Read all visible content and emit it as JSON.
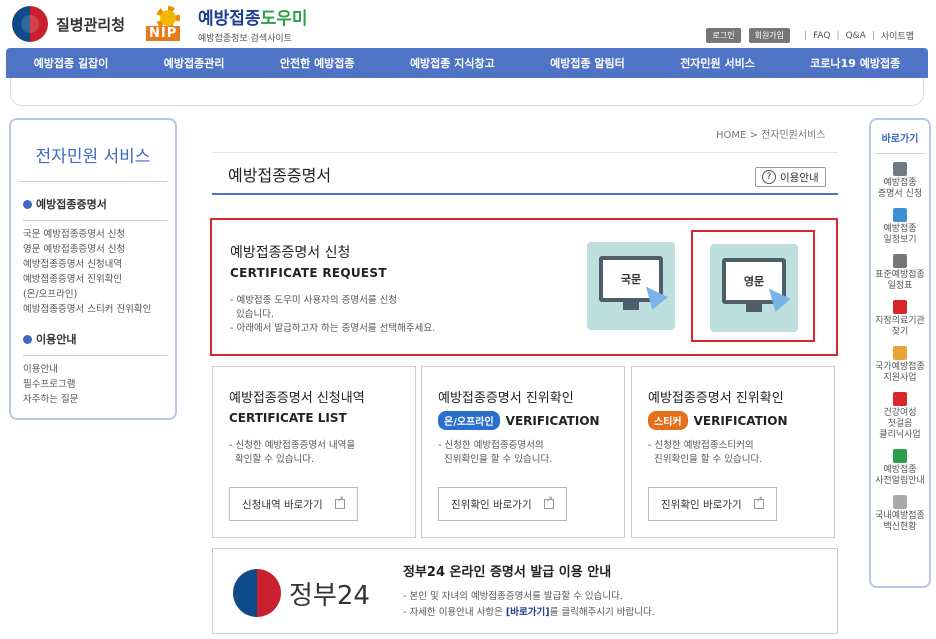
{
  "header": {
    "kdca_logo_text": "질병관리청",
    "nip_logo_text": "예방접종도우미",
    "nip_logo_text_a": "예방접종",
    "nip_logo_text_b": "도우미",
    "nip_badge": "NIP",
    "nip_sub": "예방접종정보 검색사이트",
    "util": {
      "login": "로그인",
      "join": "회원가입",
      "faq": "FAQ",
      "qa": "Q&A",
      "sitemap": "사이트맵"
    }
  },
  "gnb": [
    "예방접종 길잡이",
    "예방접종관리",
    "안전한 예방접종",
    "예방접종 지식창고",
    "예방접종 알림터",
    "전자민원 서비스",
    "코로나19 예방접종"
  ],
  "lnb": {
    "title": "전자민원 서비스",
    "group1": "예방접종증명서",
    "items1": [
      "국문 예방접종증명서 신청",
      "영문 예방접종증명서 신청",
      "예방접종증명서 신청내역",
      "예방접종증명서 진위확인",
      "(온/오프라인)",
      "예방접종증명서 스티커 진위확인"
    ],
    "group2": "이용안내",
    "items2": [
      "이용안내",
      "필수프로그램",
      "자주하는 질문"
    ]
  },
  "breadcrumb": "HOME  >  전자민원서비스",
  "page_title": "예방접종증명서",
  "usage_button": "이용안내",
  "request": {
    "title": "예방접종증명서 신청",
    "subtitle": "CERTIFICATE REQUEST",
    "desc1": "- 예방접종 도우미 사용자의 증명서를 신청",
    "desc1b": "  있습니다.",
    "desc2": "- 아래에서 발급하고자 하는 증명서를 선택해주세요.",
    "korean_tile": "국문",
    "english_tile": "영문"
  },
  "cards": [
    {
      "title": "예방접종증명서 신청내역",
      "subtitle": "CERTIFICATE LIST",
      "desc1": "- 신청한 예방접종증명서 내역을",
      "desc2": "  확인할 수 있습니다.",
      "button": "신청내역 바로가기"
    },
    {
      "title": "예방접종증명서 진위확인",
      "badge": "온/오프라인",
      "badge_color": "#2a6fd0",
      "subtitle": "VERIFICATION",
      "desc1": "- 신청한 예방접종증명서의",
      "desc2": "  진위확인을 할 수 있습니다.",
      "button": "진위확인 바로가기"
    },
    {
      "title": "예방접종증명서 진위확인",
      "badge": "스티커",
      "badge_color": "#e4701e",
      "subtitle": "VERIFICATION",
      "desc1": "- 신청한 예방접종스티커의",
      "desc2": "  진위확인을 할 수 있습니다.",
      "button": "진위확인 바로가기"
    }
  ],
  "gov24": {
    "logo": "정부24",
    "title": "정부24 온라인 증명서 발급 이용 안내",
    "desc1": "- 본인 및 자녀의 예방접종증명서를 발급할 수 있습니다.",
    "desc2_pre": "- 자세한 이용안내 사항은 ",
    "desc2_link": "[바로가기]",
    "desc2_post": "를 클릭해주시기 바랍니다."
  },
  "quick": {
    "title": "바로가기",
    "items": [
      {
        "label": "예방접종\n증명서 신청",
        "icon": "printer-icon",
        "color": "#6f7a86"
      },
      {
        "label": "예방접종\n일정보기",
        "icon": "calendar-icon",
        "color": "#3d8fd1"
      },
      {
        "label": "표준예방접종\n일정표",
        "icon": "pen-icon",
        "color": "#777777"
      },
      {
        "label": "지정의료기관\n찾기",
        "icon": "hospital-icon",
        "color": "#d9262c"
      },
      {
        "label": "국가예방접종\n지원사업",
        "icon": "document-icon",
        "color": "#e8a33a"
      },
      {
        "label": "건강여성\n첫걸음\n클리닉사업",
        "icon": "box-icon",
        "color": "#d9262c"
      },
      {
        "label": "예방접종\n사전알림안내",
        "icon": "speaker-icon",
        "color": "#2aa04a"
      },
      {
        "label": "국내예방접종\n백신현황",
        "icon": "vaccine-icon",
        "color": "#aaaaaa"
      }
    ]
  }
}
